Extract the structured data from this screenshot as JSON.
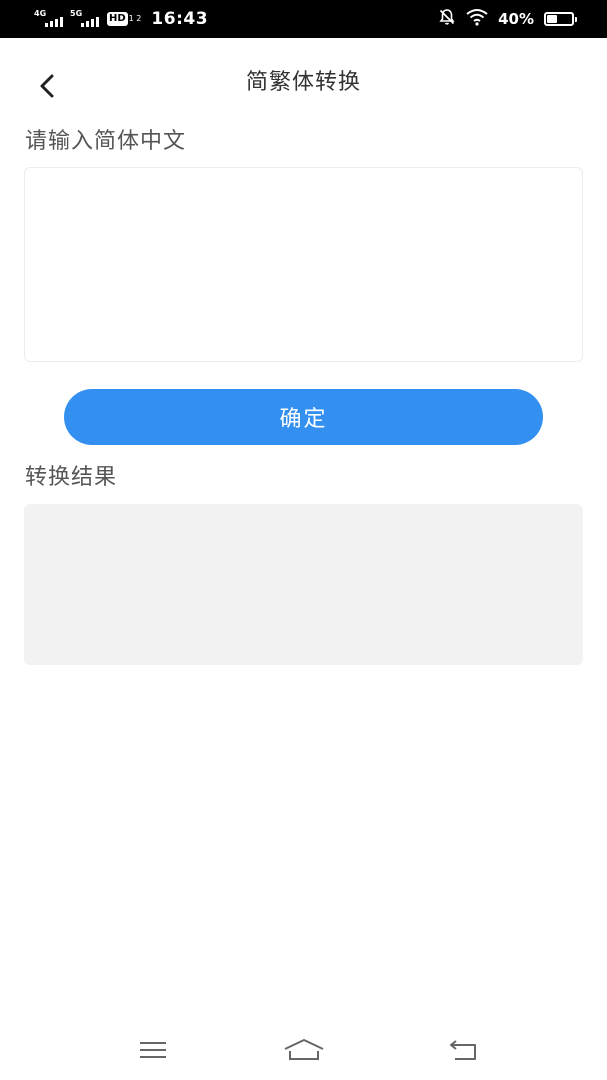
{
  "status_bar": {
    "network_1": "4G",
    "network_2": "5G",
    "hd_label": "HD",
    "hd_sub": "1 2",
    "time": "16:43",
    "battery_text": "40%",
    "battery_level": 0.4,
    "icons": [
      "signal-icon",
      "signal-icon",
      "hd-icon",
      "mute-icon",
      "wifi-icon",
      "battery-icon"
    ]
  },
  "header": {
    "back_icon": "back-arrow-icon",
    "title": "简繁体转换"
  },
  "main": {
    "input_label": "请输入简体中文",
    "input_value": "",
    "input_placeholder": "",
    "confirm_label": "确定",
    "result_label": "转换结果",
    "result_value": ""
  },
  "nav_bar": {
    "icons": [
      "menu-icon",
      "home-icon",
      "back-icon"
    ]
  },
  "colors": {
    "accent": "#3390F0",
    "status_bar_bg": "#000000",
    "result_bg": "#F2F2F2",
    "label_text": "#555555",
    "title_text": "#333333"
  }
}
